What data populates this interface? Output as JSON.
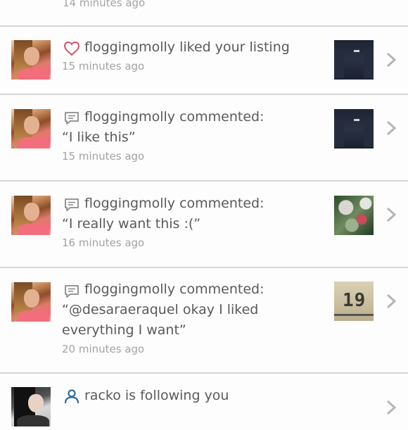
{
  "notifications": [
    {
      "type": "partial",
      "time": "14 minutes ago"
    },
    {
      "type": "like",
      "icon": "heart-icon",
      "lines": [
        "floggingmolly liked your listing"
      ],
      "time": "15 minutes ago",
      "thumb": "sweatshirt"
    },
    {
      "type": "comment",
      "icon": "comment-icon",
      "lines": [
        "floggingmolly commented:",
        "“I like this”"
      ],
      "time": "15 minutes ago",
      "thumb": "sweatshirt"
    },
    {
      "type": "comment",
      "icon": "comment-icon",
      "lines": [
        "floggingmolly commented:",
        "“I really want this :(”"
      ],
      "time": "16 minutes ago",
      "thumb": "floral"
    },
    {
      "type": "comment",
      "icon": "comment-icon",
      "lines": [
        "floggingmolly commented:",
        "“@desaraeraquel okay I liked",
        "everything I want”"
      ],
      "time": "20 minutes ago",
      "thumb": "jersey"
    },
    {
      "type": "follow",
      "icon": "person-icon",
      "lines": [
        "racko is following you"
      ]
    }
  ],
  "jersey_number": "19",
  "colors": {
    "heart": "#d25563",
    "icon": "#8a8a8a",
    "follow_icon": "#2f6fa0",
    "divider": "#d5d5d5",
    "time": "#a3a3a3"
  }
}
